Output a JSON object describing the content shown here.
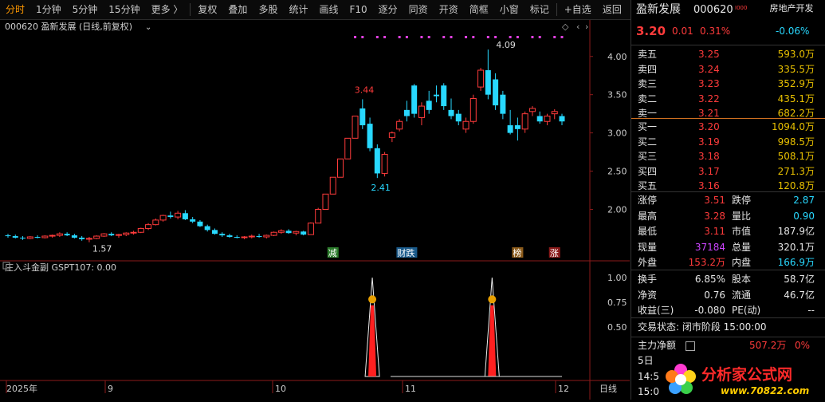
{
  "toolbar": {
    "items": [
      "分时",
      "1分钟",
      "5分钟",
      "15分钟",
      "更多 〉",
      "复权",
      "叠加",
      "多股",
      "统计",
      "画线",
      "F10",
      "逐分",
      "同资",
      "开资",
      "简框",
      "小窗",
      "标记",
      "+自选",
      "返回"
    ]
  },
  "chart": {
    "header": "000620 盈新发展 (日线,前复权)",
    "sub_indicator": "庄入斗金副 GSPT107: 0.00",
    "price_axis": [
      "4.00",
      "3.50",
      "3.00",
      "2.50",
      "2.00"
    ],
    "indicator_axis": [
      "1.00",
      "0.75",
      "0.50"
    ],
    "date_labels": [
      "2025年",
      "9",
      "10",
      "11",
      "12"
    ],
    "period_label": "日线",
    "annotations": {
      "high": "4.09",
      "peak": "3.44",
      "low": "2.41",
      "start_low": "1.57"
    },
    "tags": [
      "减",
      "财跌",
      "榜",
      "涨"
    ]
  },
  "chart_data": {
    "type": "candlestick",
    "ylim": [
      1.4,
      4.3
    ],
    "ohlc": [
      [
        1.66,
        1.68,
        1.63,
        1.65
      ],
      [
        1.65,
        1.67,
        1.62,
        1.63
      ],
      [
        1.63,
        1.65,
        1.6,
        1.62
      ],
      [
        1.62,
        1.65,
        1.61,
        1.64
      ],
      [
        1.64,
        1.66,
        1.62,
        1.63
      ],
      [
        1.63,
        1.66,
        1.62,
        1.65
      ],
      [
        1.65,
        1.67,
        1.63,
        1.66
      ],
      [
        1.66,
        1.7,
        1.64,
        1.68
      ],
      [
        1.68,
        1.7,
        1.65,
        1.66
      ],
      [
        1.66,
        1.68,
        1.62,
        1.63
      ],
      [
        1.63,
        1.65,
        1.59,
        1.61
      ],
      [
        1.61,
        1.64,
        1.57,
        1.62
      ],
      [
        1.62,
        1.66,
        1.61,
        1.65
      ],
      [
        1.65,
        1.69,
        1.64,
        1.68
      ],
      [
        1.68,
        1.7,
        1.65,
        1.66
      ],
      [
        1.66,
        1.68,
        1.63,
        1.67
      ],
      [
        1.67,
        1.7,
        1.65,
        1.69
      ],
      [
        1.69,
        1.72,
        1.67,
        1.7
      ],
      [
        1.7,
        1.76,
        1.69,
        1.75
      ],
      [
        1.75,
        1.82,
        1.73,
        1.8
      ],
      [
        1.8,
        1.88,
        1.79,
        1.86
      ],
      [
        1.86,
        1.93,
        1.84,
        1.92
      ],
      [
        1.92,
        1.97,
        1.88,
        1.9
      ],
      [
        1.9,
        1.98,
        1.87,
        1.95
      ],
      [
        1.95,
        1.99,
        1.86,
        1.87
      ],
      [
        1.87,
        1.9,
        1.82,
        1.84
      ],
      [
        1.84,
        1.86,
        1.77,
        1.78
      ],
      [
        1.78,
        1.8,
        1.71,
        1.73
      ],
      [
        1.73,
        1.75,
        1.67,
        1.68
      ],
      [
        1.68,
        1.7,
        1.64,
        1.66
      ],
      [
        1.66,
        1.68,
        1.63,
        1.64
      ],
      [
        1.64,
        1.66,
        1.62,
        1.63
      ],
      [
        1.63,
        1.65,
        1.61,
        1.64
      ],
      [
        1.64,
        1.67,
        1.62,
        1.65
      ],
      [
        1.65,
        1.68,
        1.63,
        1.64
      ],
      [
        1.64,
        1.67,
        1.62,
        1.66
      ],
      [
        1.66,
        1.71,
        1.65,
        1.7
      ],
      [
        1.7,
        1.74,
        1.68,
        1.72
      ],
      [
        1.72,
        1.74,
        1.68,
        1.69
      ],
      [
        1.69,
        1.72,
        1.66,
        1.71
      ],
      [
        1.71,
        1.72,
        1.66,
        1.67
      ],
      [
        1.67,
        1.83,
        1.67,
        1.82
      ],
      [
        1.82,
        2.02,
        1.82,
        2.0
      ],
      [
        2.0,
        2.2,
        2.0,
        2.2
      ],
      [
        2.2,
        2.42,
        2.2,
        2.42
      ],
      [
        2.42,
        2.66,
        2.42,
        2.66
      ],
      [
        2.66,
        2.93,
        2.66,
        2.93
      ],
      [
        2.93,
        3.22,
        2.93,
        3.22
      ],
      [
        3.32,
        3.44,
        3.05,
        3.1
      ],
      [
        3.12,
        3.2,
        2.76,
        2.8
      ],
      [
        2.8,
        2.85,
        2.41,
        2.47
      ],
      [
        2.47,
        2.75,
        2.43,
        2.72
      ],
      [
        2.94,
        3.02,
        2.88,
        3.0
      ],
      [
        3.05,
        3.18,
        3.02,
        3.15
      ],
      [
        3.3,
        3.42,
        3.15,
        3.22
      ],
      [
        3.62,
        3.64,
        3.2,
        3.25
      ],
      [
        3.2,
        3.4,
        3.1,
        3.35
      ],
      [
        3.42,
        3.55,
        3.25,
        3.3
      ],
      [
        3.5,
        3.62,
        3.4,
        3.48
      ],
      [
        3.62,
        3.65,
        3.3,
        3.35
      ],
      [
        3.3,
        3.45,
        3.18,
        3.22
      ],
      [
        3.25,
        3.3,
        3.1,
        3.15
      ],
      [
        3.05,
        3.2,
        3.0,
        3.15
      ],
      [
        3.15,
        3.5,
        3.12,
        3.45
      ],
      [
        3.6,
        3.85,
        3.55,
        3.82
      ],
      [
        3.82,
        4.09,
        3.44,
        3.5
      ],
      [
        3.7,
        3.78,
        3.3,
        3.36
      ],
      [
        3.5,
        3.55,
        3.18,
        3.25
      ],
      [
        3.1,
        3.3,
        2.98,
        3.0
      ],
      [
        3.1,
        3.2,
        2.9,
        3.05
      ],
      [
        3.05,
        3.28,
        3.0,
        3.25
      ],
      [
        3.28,
        3.35,
        3.22,
        3.32
      ],
      [
        3.22,
        3.28,
        3.12,
        3.15
      ],
      [
        3.15,
        3.25,
        3.1,
        3.22
      ],
      [
        3.25,
        3.31,
        3.18,
        3.28
      ],
      [
        3.22,
        3.25,
        3.1,
        3.15
      ]
    ],
    "signal_peaks": [
      49,
      65
    ]
  },
  "quote": {
    "name": "盈新发展",
    "code": "000620",
    "sector": "房地产开发",
    "sector_change": "-0.06%",
    "price": "3.20",
    "change": "0.01",
    "change_pct": "0.31%",
    "asks": [
      {
        "label": "卖五",
        "price": "3.25",
        "vol": "593.0万"
      },
      {
        "label": "卖四",
        "price": "3.24",
        "vol": "335.5万"
      },
      {
        "label": "卖三",
        "price": "3.23",
        "vol": "352.9万"
      },
      {
        "label": "卖二",
        "price": "3.22",
        "vol": "435.1万"
      },
      {
        "label": "卖一",
        "price": "3.21",
        "vol": "682.2万"
      }
    ],
    "bids": [
      {
        "label": "买一",
        "price": "3.20",
        "vol": "1094.0万"
      },
      {
        "label": "买二",
        "price": "3.19",
        "vol": "998.5万"
      },
      {
        "label": "买三",
        "price": "3.18",
        "vol": "508.1万"
      },
      {
        "label": "买四",
        "price": "3.17",
        "vol": "271.3万"
      },
      {
        "label": "买五",
        "price": "3.16",
        "vol": "120.8万"
      }
    ],
    "stats": [
      {
        "l1": "涨停",
        "v1": "3.51",
        "l2": "跌停",
        "v2": "2.87"
      },
      {
        "l1": "最高",
        "v1": "3.28",
        "l2": "量比",
        "v2": "0.90"
      },
      {
        "l1": "最低",
        "v1": "3.11",
        "l2": "市值",
        "v2": "187.9亿"
      },
      {
        "l1": "现量",
        "v1": "37184",
        "l2": "总量",
        "v2": "320.1万"
      },
      {
        "l1": "外盘",
        "v1": "153.2万",
        "l2": "内盘",
        "v2": "166.9万"
      }
    ],
    "fundamentals": [
      {
        "l1": "换手",
        "v1": "6.85%",
        "l2": "股本",
        "v2": "58.7亿"
      },
      {
        "l1": "净资",
        "v1": "0.76",
        "l2": "流通",
        "v2": "46.7亿"
      },
      {
        "l1": "收益(三)",
        "v1": "-0.080",
        "l2": "PE(动)",
        "v2": "--"
      }
    ],
    "trade_status": "交易状态: 闭市阶段 15:00:00",
    "main_flow_label": "主力净额",
    "main_flow_value": "507.2万",
    "main_flow_pct": "0%",
    "ticks": [
      "5日",
      "14:5",
      "15:0"
    ]
  },
  "logo": {
    "text": "分析家公式网",
    "url": "www.70822.com"
  },
  "colors": {
    "up": "#ff3b3b",
    "down": "#28d8ff",
    "accent": "#ff9900"
  }
}
